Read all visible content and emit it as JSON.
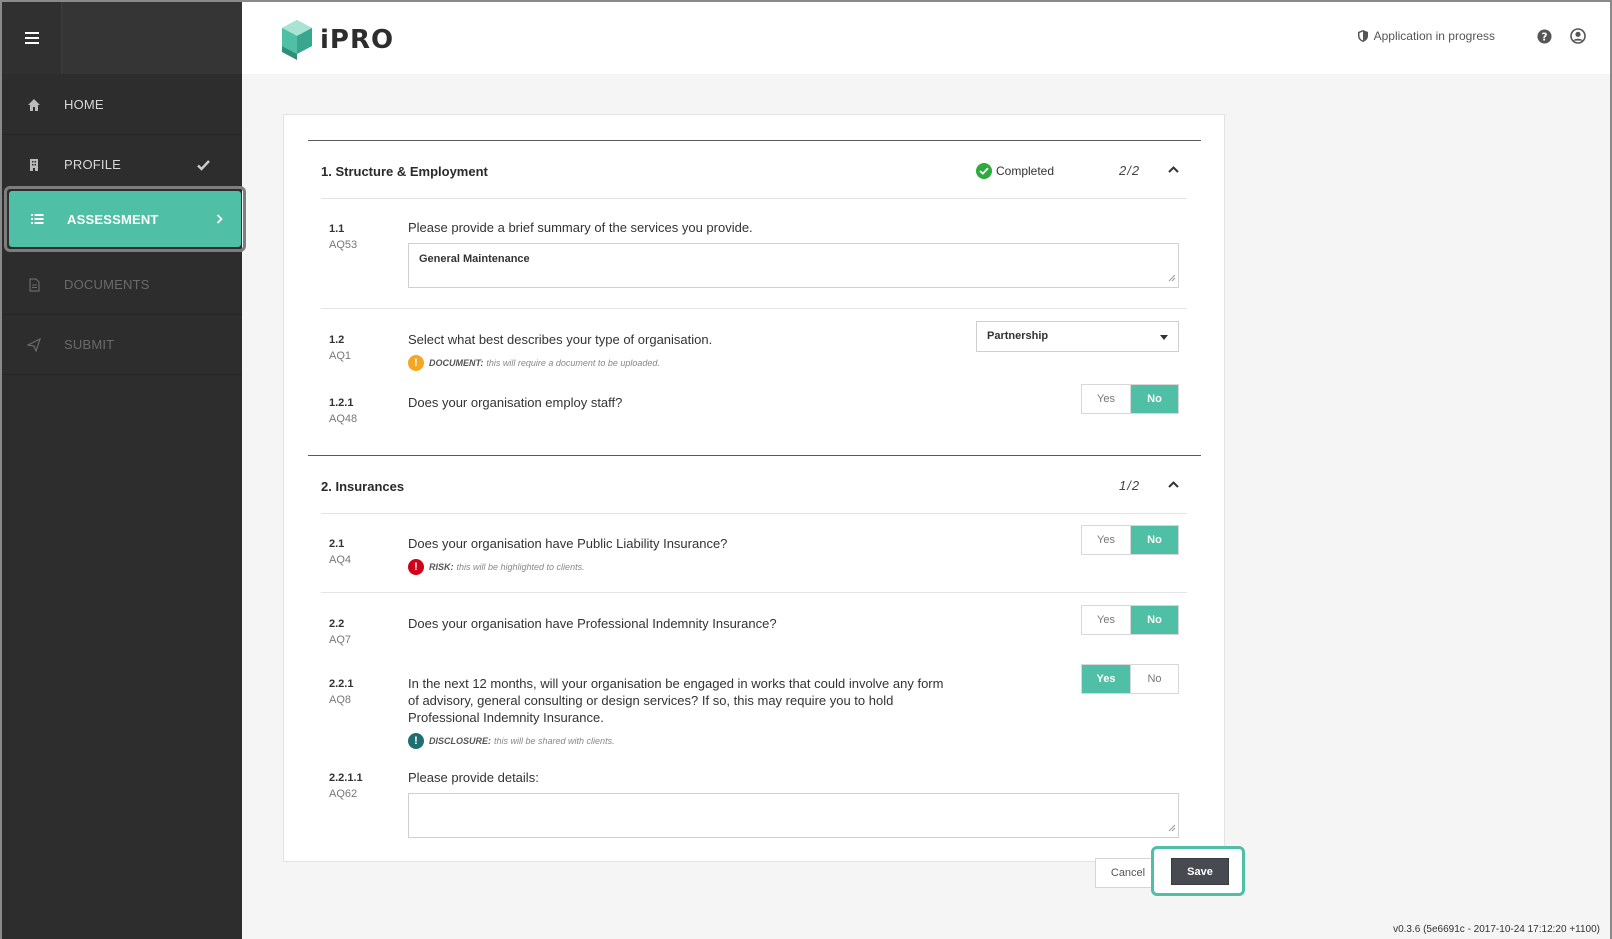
{
  "app": {
    "name": "iPRO",
    "status": "Application in progress"
  },
  "sidebar": {
    "items": [
      {
        "label": "HOME",
        "icon": "home-icon",
        "state": "normal"
      },
      {
        "label": "PROFILE",
        "icon": "building-icon",
        "state": "normal",
        "done": true
      },
      {
        "label": "ASSESSMENT",
        "icon": "list-icon",
        "state": "active"
      },
      {
        "label": "DOCUMENTS",
        "icon": "document-icon",
        "state": "disabled"
      },
      {
        "label": "SUBMIT",
        "icon": "paper-plane-icon",
        "state": "disabled"
      }
    ]
  },
  "sections": [
    {
      "title": "1. Structure & Employment",
      "status": "Completed",
      "count": "2/2",
      "questions": [
        {
          "num": "1.1",
          "code": "AQ53",
          "text": "Please provide a brief summary of the services you provide.",
          "answer": "General Maintenance"
        },
        {
          "num": "1.2",
          "code": "AQ1",
          "text": "Select what best describes your type of organisation.",
          "note_label": "DOCUMENT:",
          "note_text": "this will require a document to be uploaded.",
          "selected": "Partnership"
        },
        {
          "num": "1.2.1",
          "code": "AQ48",
          "text": "Does your organisation employ staff?",
          "yes": "Yes",
          "no": "No",
          "value": "No"
        }
      ]
    },
    {
      "title": "2. Insurances",
      "count": "1/2",
      "questions": [
        {
          "num": "2.1",
          "code": "AQ4",
          "text": "Does your organisation have Public Liability Insurance?",
          "note_label": "RISK:",
          "note_text": "this will be highlighted to clients.",
          "yes": "Yes",
          "no": "No",
          "value": "No"
        },
        {
          "num": "2.2",
          "code": "AQ7",
          "text": "Does your organisation have Professional Indemnity Insurance?",
          "yes": "Yes",
          "no": "No",
          "value": "No"
        },
        {
          "num": "2.2.1",
          "code": "AQ8",
          "text_lines": [
            "In the next 12 months, will your organisation be engaged in works that could involve any form",
            "of advisory, general consulting or design services? If so, this may require you to hold",
            "Professional Indemnity Insurance."
          ],
          "note_label": "DISCLOSURE:",
          "note_text": "this will be shared with clients.",
          "yes": "Yes",
          "no": "No",
          "value": "Yes"
        },
        {
          "num": "2.2.1.1",
          "code": "AQ62",
          "text": "Please provide details:",
          "answer": ""
        }
      ]
    }
  ],
  "actions": {
    "cancel": "Cancel",
    "save": "Save"
  },
  "version": "v0.3.6 (5e6691c - 2017-10-24 17:12:20 +1100)",
  "colors": {
    "accent": "#4fbfa5",
    "sidebar": "#2d2d2d",
    "completed": "#2eaa3e",
    "document": "#f5a623",
    "risk": "#d0021b",
    "disclosure": "#1f6f72"
  }
}
